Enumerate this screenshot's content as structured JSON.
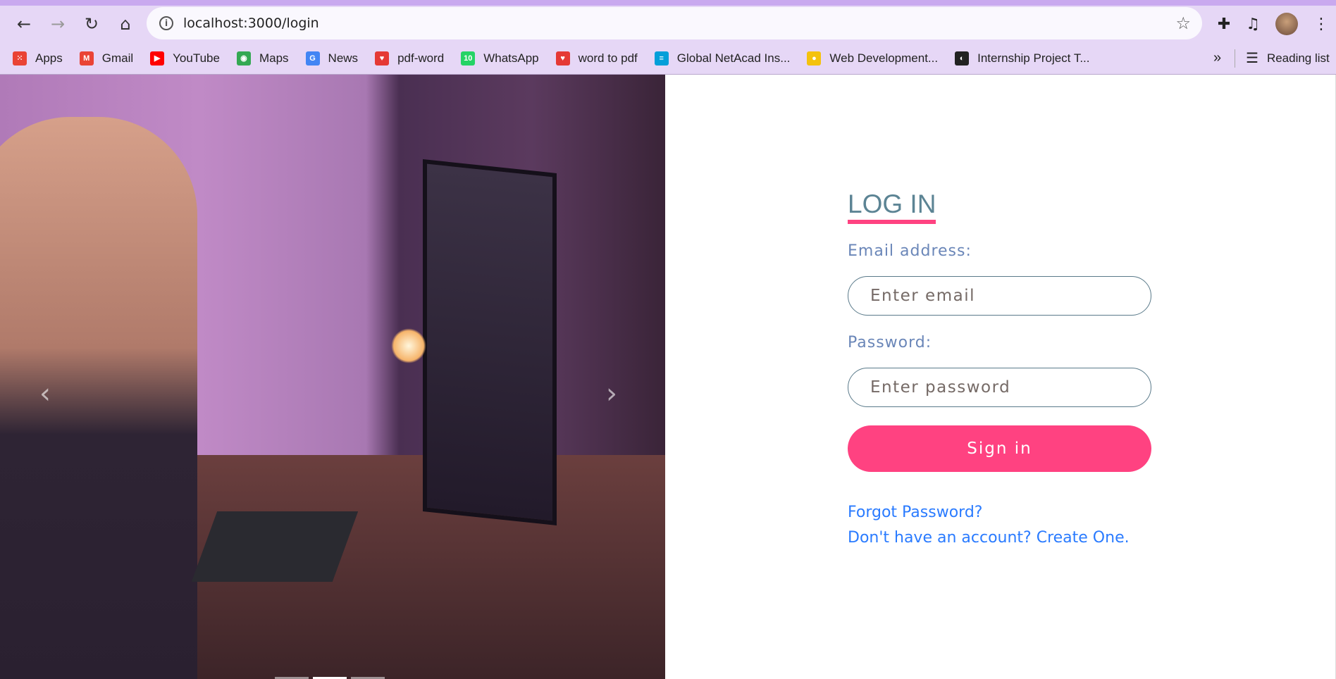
{
  "browser": {
    "url": "localhost:3000/login",
    "bookmarks": [
      {
        "label": "Apps",
        "icon": "apps-grid-icon",
        "color": "#ea4335"
      },
      {
        "label": "Gmail",
        "icon": "gmail-icon",
        "color": "#ea4335"
      },
      {
        "label": "YouTube",
        "icon": "youtube-icon",
        "color": "#ff0000"
      },
      {
        "label": "Maps",
        "icon": "maps-icon",
        "color": "#34a853"
      },
      {
        "label": "News",
        "icon": "news-icon",
        "color": "#4285f4"
      },
      {
        "label": "pdf-word",
        "icon": "pdf-icon",
        "color": "#e53935"
      },
      {
        "label": "WhatsApp",
        "icon": "whatsapp-icon",
        "color": "#25d366"
      },
      {
        "label": "word to pdf",
        "icon": "pdf-icon",
        "color": "#e53935"
      },
      {
        "label": "Global NetAcad Ins...",
        "icon": "cisco-icon",
        "color": "#049fd9"
      },
      {
        "label": "Web Development...",
        "icon": "web-dev-icon",
        "color": "#f4c20d"
      },
      {
        "label": "Internship Project T...",
        "icon": "globe-icon",
        "color": "#222222"
      }
    ],
    "more": "»",
    "reading_list": "Reading list"
  },
  "login": {
    "title": "LOG IN",
    "email_label": "Email address:",
    "email_placeholder": "Enter email",
    "password_label": "Password:",
    "password_placeholder": "Enter password",
    "signin_label": "Sign in",
    "forgot": "Forgot Password?",
    "create": "Don't have an account? Create One."
  },
  "carousel": {
    "prev": "‹",
    "next": "›",
    "slides": 3,
    "active": 2
  },
  "colors": {
    "accent": "#ff4281",
    "title": "#5c8494",
    "label": "#6a86b8",
    "link": "#2a7bff"
  }
}
